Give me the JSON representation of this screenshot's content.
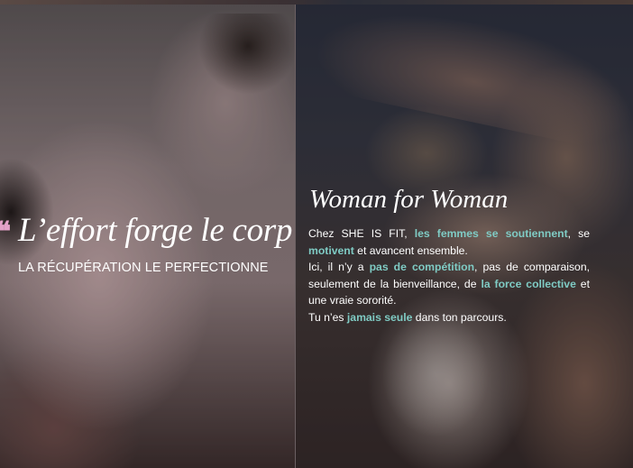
{
  "left_panel": {
    "quote_mark": "❝",
    "headline": "L’effort forge le corp",
    "subhead": "LA RÉCUPÉRATION LE PERFECTIONNE"
  },
  "right_panel": {
    "title": "Woman for Woman",
    "p1": {
      "t1": "Chez SHE IS FIT, ",
      "h1": "les femmes se soutiennent",
      "t2": ", se ",
      "h2": "motivent",
      "t3": " et avancent ensemble."
    },
    "p2": {
      "t1": "Ici, il n’y a ",
      "h1": "pas de compétition",
      "t2": ", pas de comparaison, seulement de la bienveillance, de ",
      "h2": "la force collective",
      "t3": " et une vraie sororité."
    },
    "p3": {
      "t1": "Tu n’es ",
      "h1": "jamais seule",
      "t2": " dans ton parcours."
    }
  },
  "colors": {
    "accent_teal": "#7fcbc4",
    "accent_pink": "#e3a1c7",
    "text": "#ffffff"
  }
}
